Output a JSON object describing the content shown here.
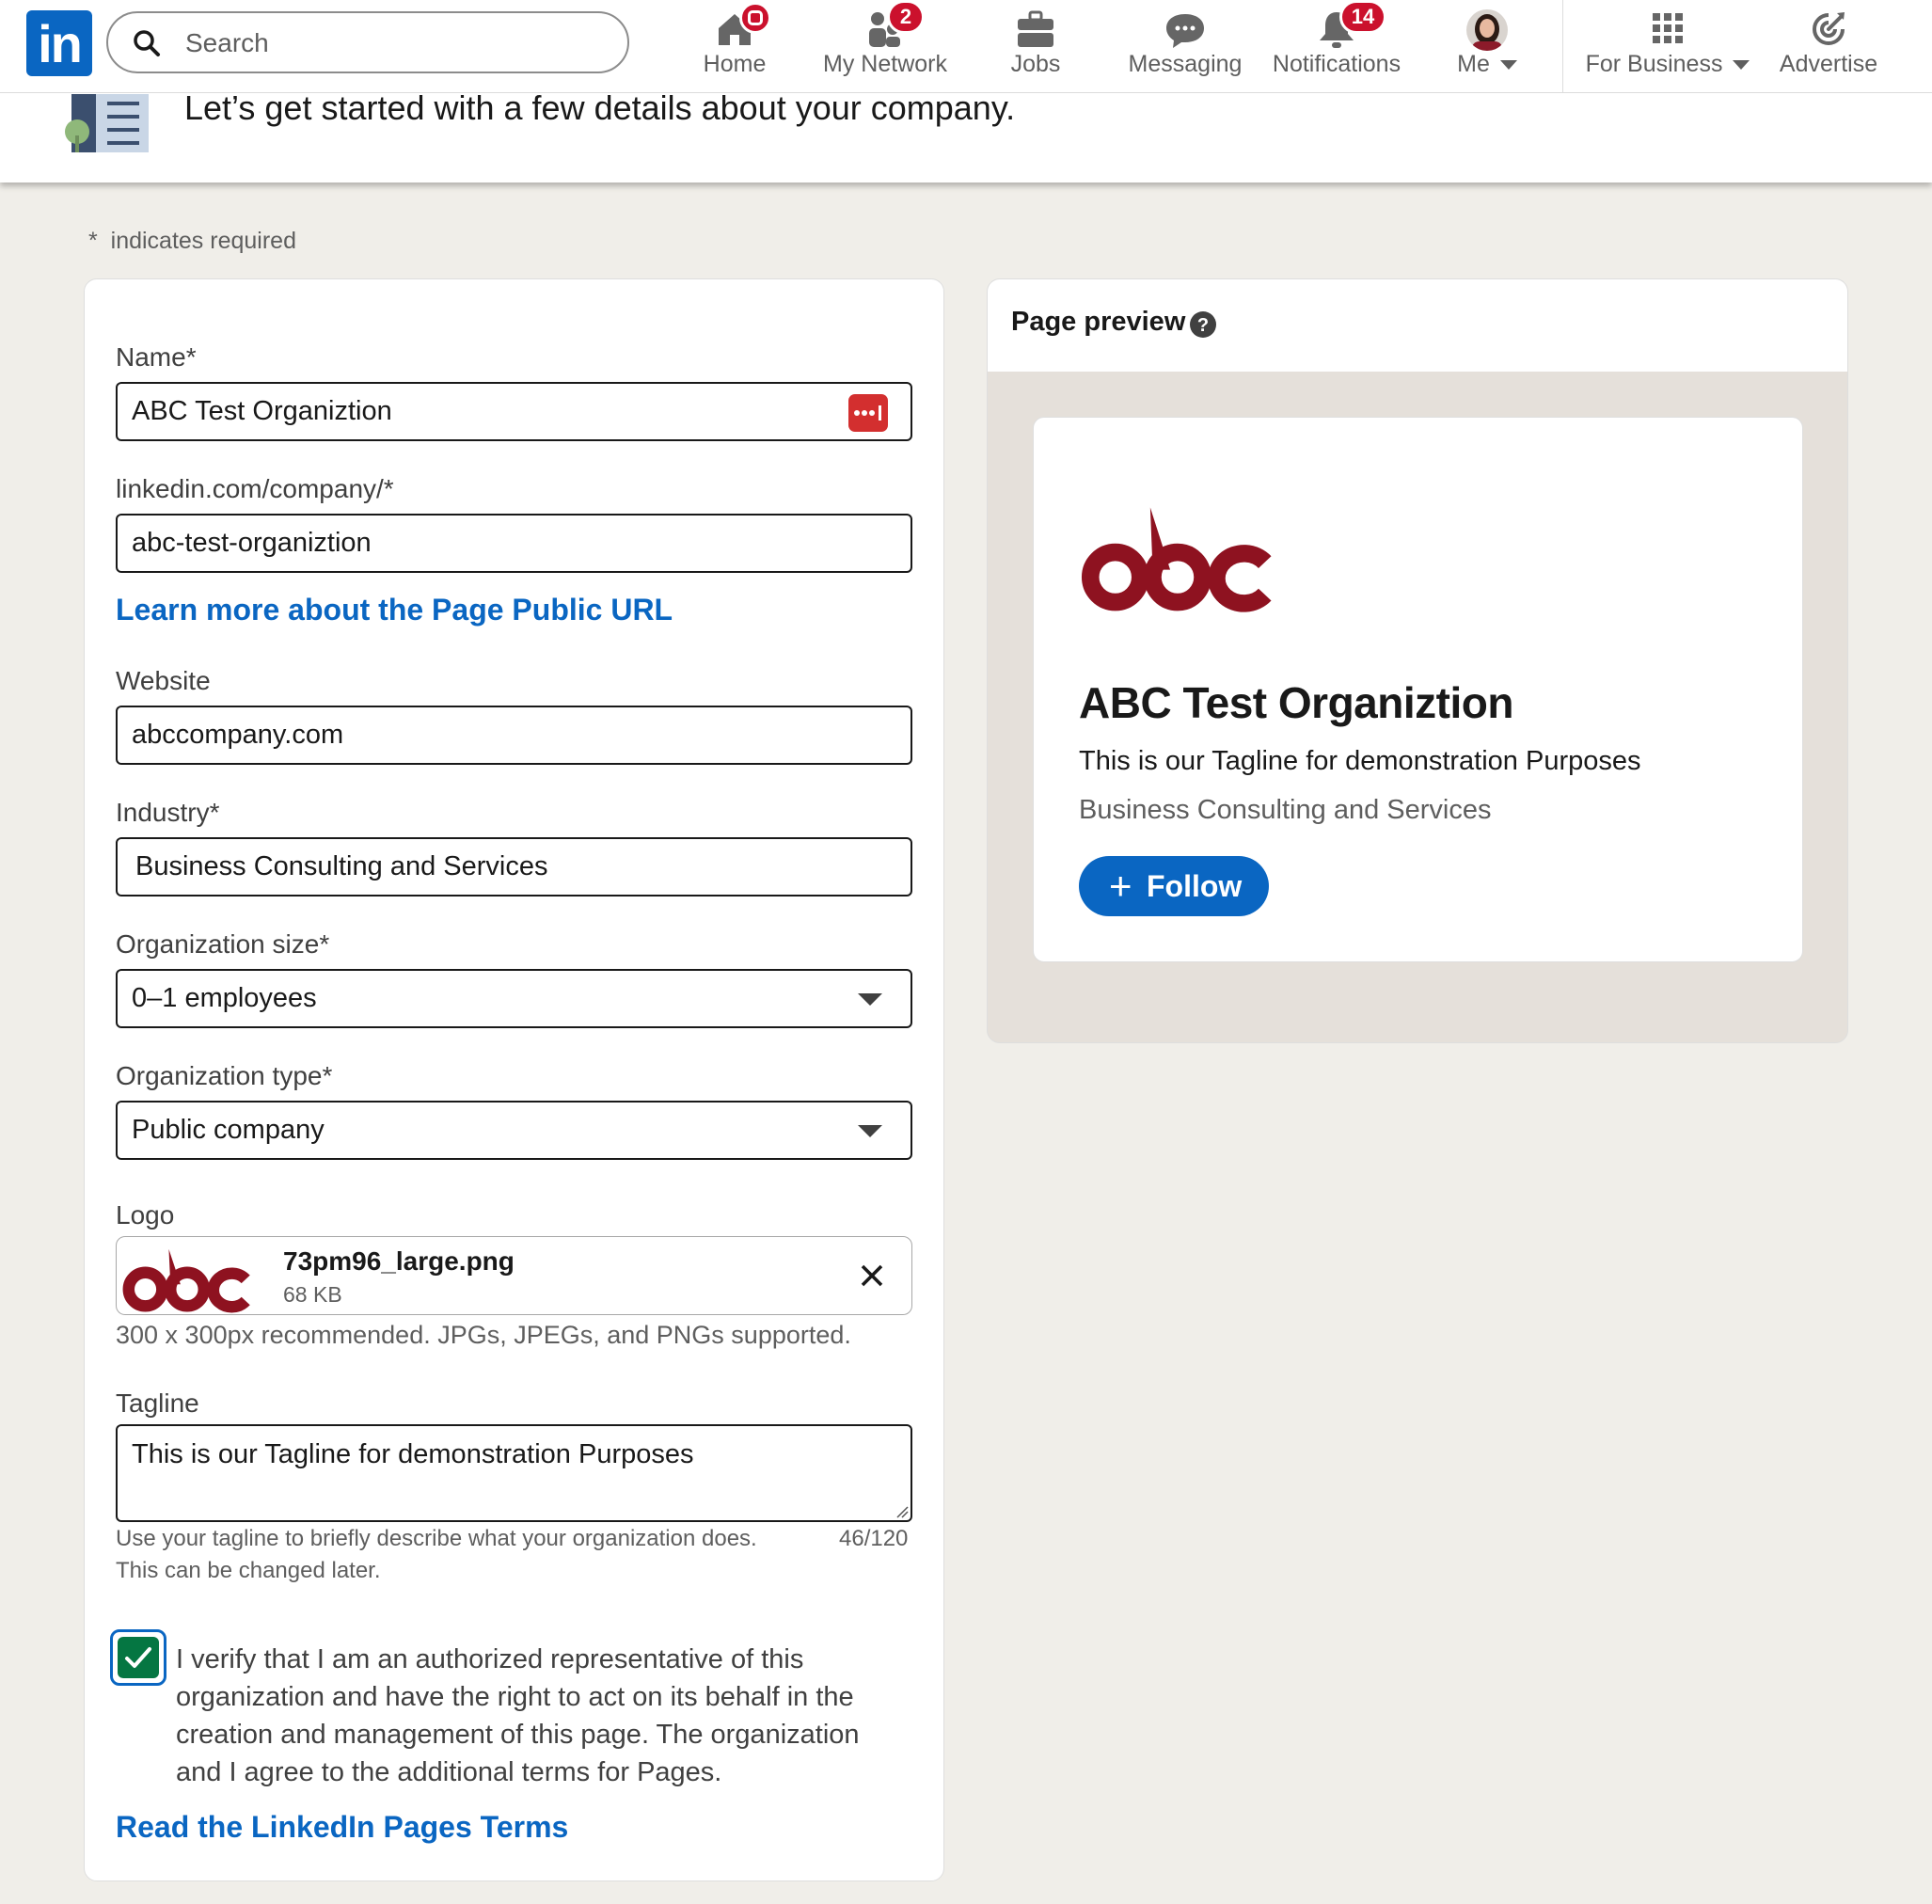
{
  "nav": {
    "search_placeholder": "Search",
    "items": [
      {
        "label": "Home",
        "icon": "home-icon"
      },
      {
        "label": "My Network",
        "icon": "people-icon",
        "badge": "2"
      },
      {
        "label": "Jobs",
        "icon": "briefcase-icon"
      },
      {
        "label": "Messaging",
        "icon": "chat-icon"
      },
      {
        "label": "Notifications",
        "icon": "bell-icon",
        "badge": "14"
      },
      {
        "label": "Me",
        "icon": "avatar"
      },
      {
        "label": "For Business",
        "icon": "grid-icon"
      },
      {
        "label": "Advertise",
        "icon": "advertise-icon"
      }
    ]
  },
  "header": {
    "title": "Let’s get started with a few details about your company."
  },
  "form": {
    "required_note": "indicates required",
    "required_star": "*",
    "name_label": "Name*",
    "name_value": "ABC Test Organiztion",
    "url_label": "linkedin.com/company/*",
    "url_value": "abc-test-organiztion",
    "url_link": "Learn more about the Page Public URL",
    "website_label": "Website",
    "website_value": "abccompany.com",
    "industry_label": "Industry*",
    "industry_value": "Business Consulting and Services",
    "size_label": "Organization size*",
    "size_value": "0–1 employees",
    "type_label": "Organization type*",
    "type_value": "Public company",
    "logo_label": "Logo",
    "logo_filename": "73pm96_large.png",
    "logo_filesize": "68 KB",
    "logo_hint": "300 x 300px recommended. JPGs, JPEGs, and PNGs supported.",
    "tagline_label": "Tagline",
    "tagline_value": "This is our Tagline for demonstration Purposes",
    "tagline_hint_1": "Use your tagline to briefly describe what your organization does.",
    "tagline_hint_2": "This can be changed later.",
    "tagline_count": "46/120",
    "verify_text_1": "I verify that I am an authorized representative of this",
    "verify_text_2": "organization and have the right to act on its behalf in the",
    "verify_text_3": "creation and management of this page. The organization",
    "verify_text_4": "and I agree to the additional terms for Pages.",
    "verify_checked": true,
    "terms_link": "Read the LinkedIn Pages Terms"
  },
  "preview": {
    "title": "Page preview",
    "org_name": "ABC Test Organiztion",
    "tagline": "This is our Tagline for demonstration Purposes",
    "industry": "Business Consulting and Services",
    "follow_label": "Follow",
    "logo_color": "#8e1220"
  },
  "colors": {
    "brand_blue": "#0a66c2",
    "badge_red": "#cb112d",
    "checkbox_green": "#057642"
  }
}
